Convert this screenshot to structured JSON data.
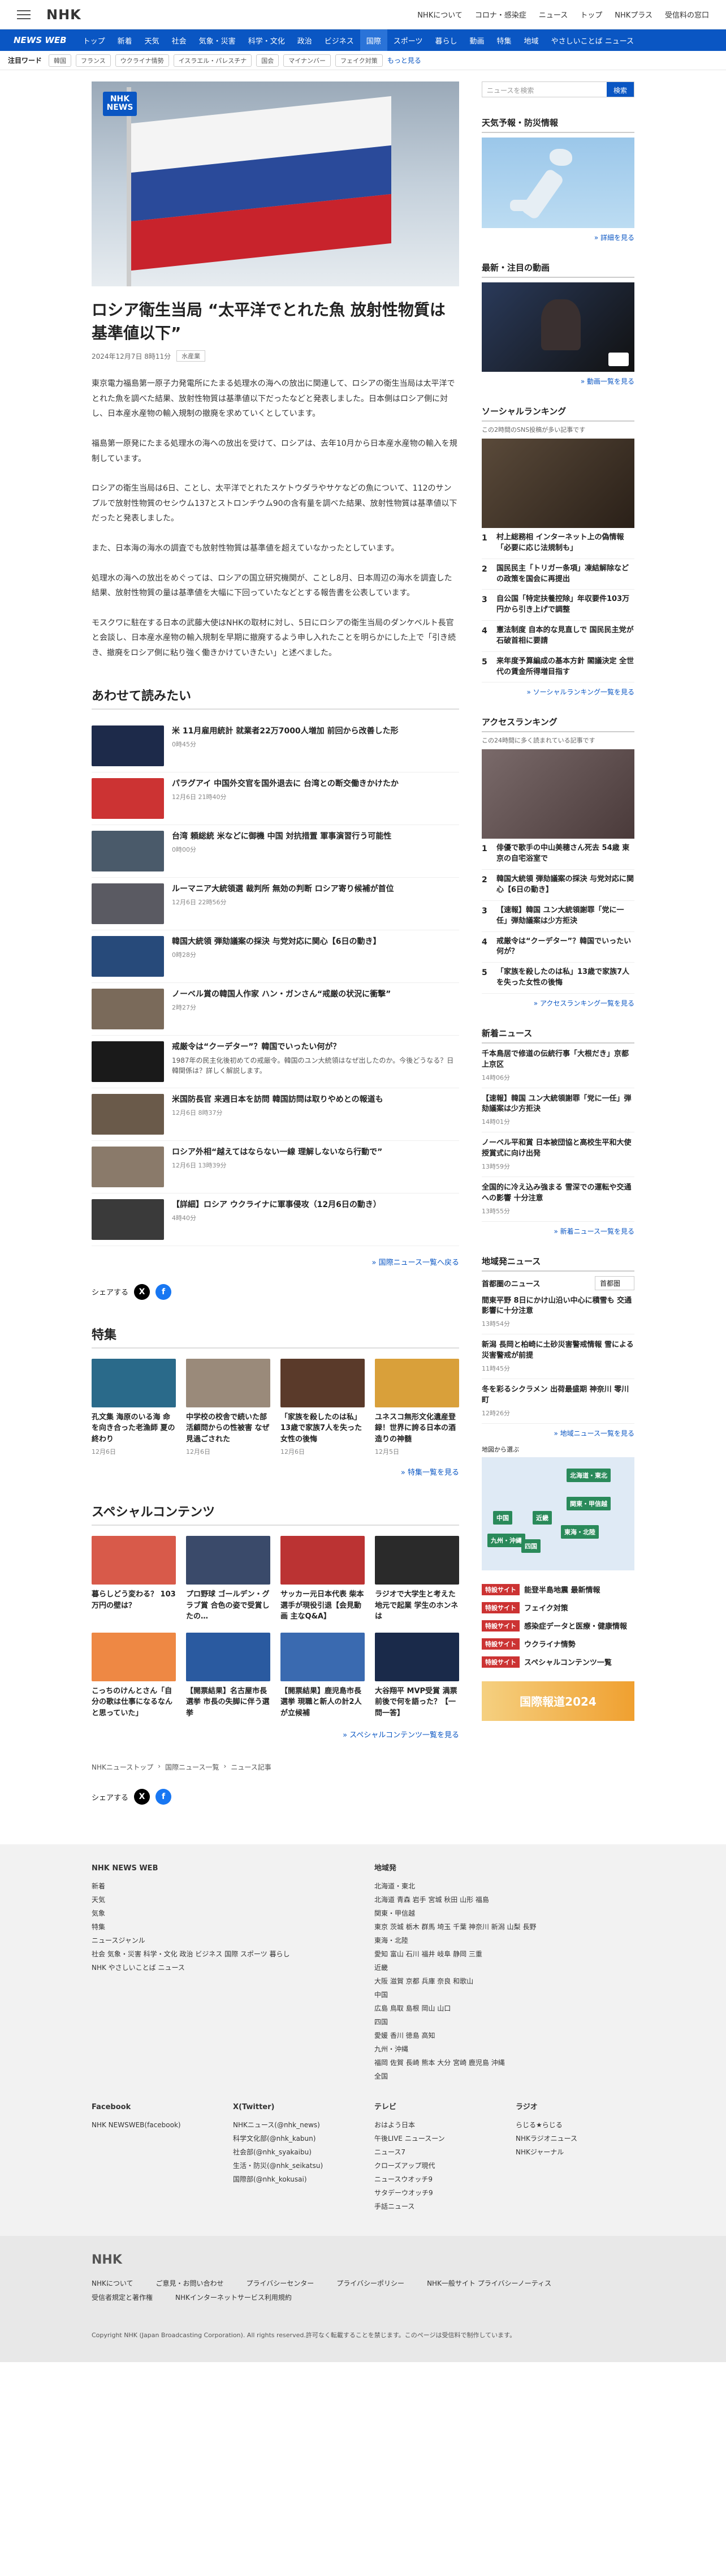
{
  "header": {
    "logo": "NHK",
    "links": [
      "NHKについて",
      "コロナ・感染症",
      "ニュース",
      "トップ",
      "NHKプラス",
      "受信料の窓口"
    ]
  },
  "nav": {
    "brand": "NEWS WEB",
    "items": [
      "トップ",
      "新着",
      "天気",
      "社会",
      "気象・災害",
      "科学・文化",
      "政治",
      "ビジネス",
      "国際",
      "スポーツ",
      "暮らし",
      "動画",
      "特集",
      "地域",
      "やさしいことば ニュース"
    ],
    "active_index": 8
  },
  "trend": {
    "label": "注目ワード",
    "tags": [
      "韓国",
      "フランス",
      "ウクライナ情勢",
      "イスラエル・パレスチナ",
      "国会",
      "マイナンバー",
      "フェイク対策"
    ],
    "more": "もっと見る"
  },
  "article": {
    "badge": "NHK NEWS",
    "title": "ロシア衛生当局 “太平洋でとれた魚 放射性物質は基準値以下”",
    "date": "2024年12月7日 8時11分",
    "category": "水産業",
    "paragraphs": [
      "東京電力福島第一原子力発電所にたまる処理水の海への放出に関連して、ロシアの衛生当局は太平洋でとれた魚を調べた結果、放射性物質は基準値以下だったなどと発表しました。日本側はロシア側に対し、日本産水産物の輸入規制の撤廃を求めていくとしています。",
      "福島第一原発にたまる処理水の海への放出を受けて、ロシアは、去年10月から日本産水産物の輸入を規制しています。",
      "ロシアの衛生当局は6日、ことし、太平洋でとれたスケトウダラやサケなどの魚について、112のサンプルで放射性物質のセシウム137とストロンチウム90の含有量を調べた結果、放射性物質は基準値以下だったと発表しました。",
      "また、日本海の海水の調査でも放射性物質は基準値を超えていなかったとしています。",
      "処理水の海への放出をめぐっては、ロシアの国立研究機関が、ことし8月、日本周辺の海水を調査した結果、放射性物質の量は基準値を大幅に下回っていたなどとする報告書を公表しています。",
      "モスクワに駐在する日本の武藤大使はNHKの取材に対し、5日にロシアの衛生当局のダンケベルト長官と会談し、日本産水産物の輸入規制を早期に撤廃するよう申し入れたことを明らかにした上で「引き続き、撤廃をロシア側に粘り強く働きかけていきたい」と述べました。"
    ]
  },
  "related": {
    "heading": "あわせて読みたい",
    "items": [
      {
        "title": "米 11月雇用統計 就業者22万7000人増加 前回から改善した形",
        "date": "0時45分",
        "color": "#1d2a4a"
      },
      {
        "title": "パラグアイ 中国外交官を国外退去に 台湾との断交働きかけたか",
        "date": "12月6日 21時40分",
        "color": "#c33"
      },
      {
        "title": "台湾 頼総統 米などに御機 中国 対抗措置 軍事演習行う可能性",
        "date": "0時00分",
        "color": "#4a5a6a"
      },
      {
        "title": "ルーマニア大統領選 裁判所 無効の判断 ロシア寄り候補が首位",
        "date": "12月6日 22時56分",
        "color": "#5a5a62"
      },
      {
        "title": "韓国大統領 弾劾議案の採決 与党対応に関心【6日の動き】",
        "date": "0時28分",
        "color": "#274a7a"
      },
      {
        "title": "ノーベル賞の韓国人作家 ハン・ガンさん“戒厳の状況に衝撃”",
        "date": "2時27分",
        "color": "#7a6a5a"
      },
      {
        "title": "戒厳令は“クーデター”？韓国でいったい何が？",
        "date": "",
        "excerpt": "1987年の民主化後初めての戒厳令。韓国のユン大統領はなぜ出したのか。今後どうなる？日韓関係は？詳しく解説します。",
        "color": "#1a1a1a"
      },
      {
        "title": "米国防長官 来週日本を訪問 韓国訪問は取りやめとの報道も",
        "date": "12月6日 8時37分",
        "color": "#6a5a4a"
      },
      {
        "title": "ロシア外相“越えてはならない一線 理解しないなら行動で”",
        "date": "12月6日 13時39分",
        "color": "#8a7a6a"
      },
      {
        "title": "【詳細】ロシア ウクライナに軍事侵攻（12月6日の動き）",
        "date": "4時40分",
        "color": "#3a3a3a"
      }
    ],
    "more": "国際ニュース一覧へ戻る"
  },
  "share": {
    "label": "シェアする"
  },
  "features": {
    "heading": "特集",
    "items": [
      {
        "title": "孔文集 海原のいる海 命を向き合った老漁師 夏の終わり",
        "date": "12月6日",
        "color": "#2a6a8a"
      },
      {
        "title": "中学校の校舎で続いた部活顧問からの性被害 なぜ見過ごされた",
        "date": "12月6日",
        "color": "#9a8a7a"
      },
      {
        "title": "「家族を殺したのは私」13歳で家族7人を失った女性の後悔",
        "date": "12月6日",
        "color": "#5a3a2a"
      },
      {
        "title": "ユネスコ無形文化遺産登録！世界に誇る日本の酒造りの神髄",
        "date": "12月5日",
        "color": "#d9a03a"
      }
    ],
    "more": "特集一覧を見る"
  },
  "special": {
    "heading": "スペシャルコンテンツ",
    "items": [
      {
        "title": "暮らしどう変わる？ 103万円の壁は？",
        "color": "#d85a4a"
      },
      {
        "title": "プロ野球 ゴールデン・グラブ賞 合色の姿で受賞したの…",
        "color": "#3a4a6a"
      },
      {
        "title": "サッカー元日本代表 柴本選手が現役引退【会見動画 主なQ&A】",
        "color": "#b33"
      },
      {
        "title": "ラジオで大学生と考えた 地元で起業 学生のホンネは",
        "color": "#2a2a2a"
      },
      {
        "title": "こっちのけんとさん「自分の歌は仕事になるなんと思っていた」",
        "color": "#e84"
      },
      {
        "title": "【開票結果】名古屋市長選挙 市長の失脚に伴う選挙",
        "color": "#2a5aa0"
      },
      {
        "title": "【開票結果】鹿児島市長選挙 現職と新人の計2人が立候補",
        "color": "#3a6ab0"
      },
      {
        "title": "大谷翔平 MVP受賞 満票前後で何を語った？【一問一答】",
        "color": "#1a2a4a"
      }
    ],
    "more": "スペシャルコンテンツ一覧を見る"
  },
  "breadcrumb": [
    "NHKニューストップ",
    "国際ニュース一覧",
    "ニュース記事"
  ],
  "sidebar": {
    "search_placeholder": "ニュースを検索",
    "search_button": "検索",
    "weather": {
      "title": "天気予報・防災情報",
      "link": "詳細を見る"
    },
    "video": {
      "title": "最新・注目の動画",
      "link": "動画一覧を見る"
    },
    "social": {
      "title": "ソーシャルランキング",
      "sub": "この2時間のSNS投稿が多い記事です",
      "items": [
        "村上総務相 インターネット上の偽情報「必要に応じ法規制も」",
        "国民民主「トリガー条項」凍結解除などの政策を国会に再提出",
        "自公国「特定扶養控除」年収要件103万円から引き上げで調整",
        "憲法制度 自本的な見直しで 国民民主党が石破首相に要請",
        "来年度予算編成の基本方針 閣議決定 全世代の賃金所得増目指す"
      ],
      "link": "ソーシャルランキング一覧を見る"
    },
    "access": {
      "title": "アクセスランキング",
      "sub": "この24時間に多く読まれている記事です",
      "items": [
        "俳優で歌手の中山美穂さん死去 54歳 東京の自宅浴室で",
        "韓国大統領 弾劾議案の採決 与党対応に関心【6日の動き】",
        "【速報】韓国 ユン大統領謝罪「党に一任」弾劾議案は少方拒決",
        "戒厳令は“クーデター”？韓国でいったい何が？",
        "「家族を殺したのは私」13歳で家族7人を失った女性の後悔"
      ],
      "link": "アクセスランキング一覧を見る"
    },
    "latest": {
      "title": "新着ニュース",
      "items": [
        {
          "t": "千本鳥居で修道の伝統行事「大根だき」京都 上京区",
          "d": "14時06分"
        },
        {
          "t": "【速報】韓国 ユン大統領謝罪「党に一任」弾劾議案は少方拒決",
          "d": "14時01分"
        },
        {
          "t": "ノーベル平和賞 日本被団協と高校生平和大使 授賞式に向け出発",
          "d": "13時59分"
        },
        {
          "t": "全国的に冷え込み強まる 雪深での運転や交通への影響 十分注意",
          "d": "13時55分"
        }
      ],
      "link": "新着ニュース一覧を見る"
    },
    "local": {
      "title": "地域発ニュース",
      "region": "首都圏のニュース",
      "select": "首都圏",
      "items": [
        {
          "t": "間東平野 8日にかけ山沿い中心に積雪も 交通影響に十分注意",
          "d": "13時54分"
        },
        {
          "t": "新潟 長岡と柏崎に土砂災害警戒情報 雪による災害警戒が前提",
          "d": "11時45分"
        },
        {
          "t": "冬を彩るシクラメン 出荷最盛期 神奈川 零川町",
          "d": "12時26分"
        }
      ],
      "link": "地域ニュース一覧を見る",
      "map_label": "地図から選ぶ",
      "regions": [
        "北海道・東北",
        "関東・甲信越",
        "近畿",
        "中国",
        "東海・北陸",
        "九州・沖縄",
        "四国"
      ]
    },
    "special_links": [
      {
        "lab": "特設サイト",
        "t": "能登半島地震 最新情報"
      },
      {
        "lab": "特設サイト",
        "t": "フェイク対策"
      },
      {
        "lab": "特設サイト",
        "t": "感染症データと医療・健康情報"
      },
      {
        "lab": "特設サイト",
        "t": "ウクライナ情勢"
      },
      {
        "lab": "特設サイト",
        "t": "スペシャルコンテンツ一覧"
      }
    ],
    "banner": "国際報道2024"
  },
  "footer": {
    "nhk_news_web": "NHK NEWS WEB",
    "col1": [
      "新着",
      "天気",
      "気象",
      "特集",
      "ニュースジャンル",
      "社会 気象・災害 科学・文化 政治 ビジネス 国際 スポーツ 暮らし",
      "NHK やさしいことば ニュース"
    ],
    "col2_title": "地域発",
    "col2": [
      "北海道・東北",
      "北海道 青森 岩手 宮城 秋田 山形 福島",
      "関東・甲信越",
      "東京 茨城 栃木 群馬 埼玉 千葉 神奈川 新潟 山梨 長野",
      "東海・北陸",
      "愛知 富山 石川 福井 岐阜 静岡 三重",
      "近畿",
      "大阪 滋賀 京都 兵庫 奈良 和歌山",
      "中国",
      "広島 鳥取 島根 岡山 山口",
      "四国",
      "愛媛 香川 徳島 高知",
      "九州・沖縄",
      "福岡 佐賀 長崎 熊本 大分 宮崎 鹿児島 沖縄",
      "全国"
    ],
    "social": {
      "facebook": "Facebook",
      "fb_link": "NHK NEWSWEB(facebook)",
      "x": "X(Twitter)",
      "x_links": [
        "NHKニュース(@nhk_news)",
        "科学文化部(@nhk_kabun)",
        "社会部(@nhk_syakaibu)",
        "生活・防災(@nhk_seikatsu)",
        "国際部(@nhk_kokusai)"
      ],
      "tv": "テレビ",
      "tv_links": [
        "おはよう日本",
        "午後LIVE ニュースーン",
        "ニュース7",
        "クローズアップ現代",
        "ニュースウオッチ9",
        "サタデーウオッチ9",
        "手話ニュース"
      ],
      "radio": "ラジオ",
      "radio_links": [
        "らじる★らじる",
        "NHKラジオニュース",
        "NHKジャーナル"
      ]
    },
    "bottom_logo": "NHK",
    "bottom_links": [
      "NHKについて",
      "ご意見・お問い合わせ",
      "プライバシーセンター",
      "プライバシーポリシー",
      "NHK一般サイト プライバシーノーティス",
      "受信者規定と著作権",
      "NHKインターネットサービス利用規約"
    ],
    "copyright": "Copyright NHK (Japan Broadcasting Corporation). All rights reserved.許可なく転載することを禁じます。このページは受信料で制作しています。"
  }
}
